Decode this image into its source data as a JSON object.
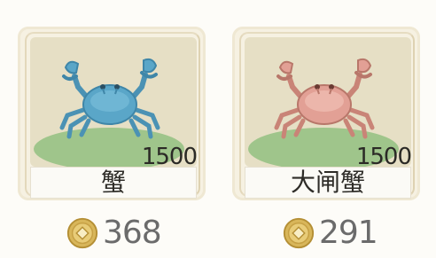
{
  "items": [
    {
      "name": "蟹",
      "count": "1500",
      "price": "368",
      "icon": "blue-crab-icon",
      "crab_color": "#5aa6c8"
    },
    {
      "name": "大闸蟹",
      "count": "1500",
      "price": "291",
      "icon": "hairy-crab-icon",
      "crab_color": "#e2a095"
    }
  ],
  "colors": {
    "card_bg": "#f6f1e2",
    "grass": "#9fc58b",
    "coin": "#d8b65a"
  }
}
